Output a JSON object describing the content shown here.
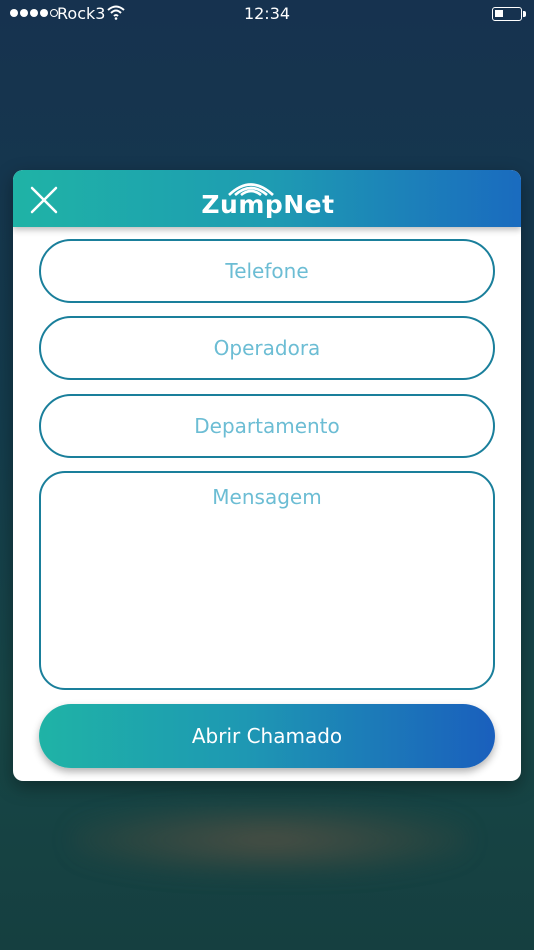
{
  "status_bar": {
    "carrier": "Rock3",
    "time": "12:34",
    "signal_bars_filled": 4,
    "signal_bars_total": 5,
    "battery_level": 0.35
  },
  "modal": {
    "logo_text": "ZumpNet",
    "close_icon": "close-icon",
    "fields": {
      "telefone": "Telefone",
      "operadora": "Operadora",
      "departamento": "Departamento",
      "mensagem": "Mensagem"
    },
    "submit_label": "Abrir Chamado"
  },
  "colors": {
    "accent_start": "#1fb3a6",
    "accent_end": "#1a5fbd",
    "field_border": "#1a7f9b",
    "placeholder": "#6cbdd4"
  }
}
